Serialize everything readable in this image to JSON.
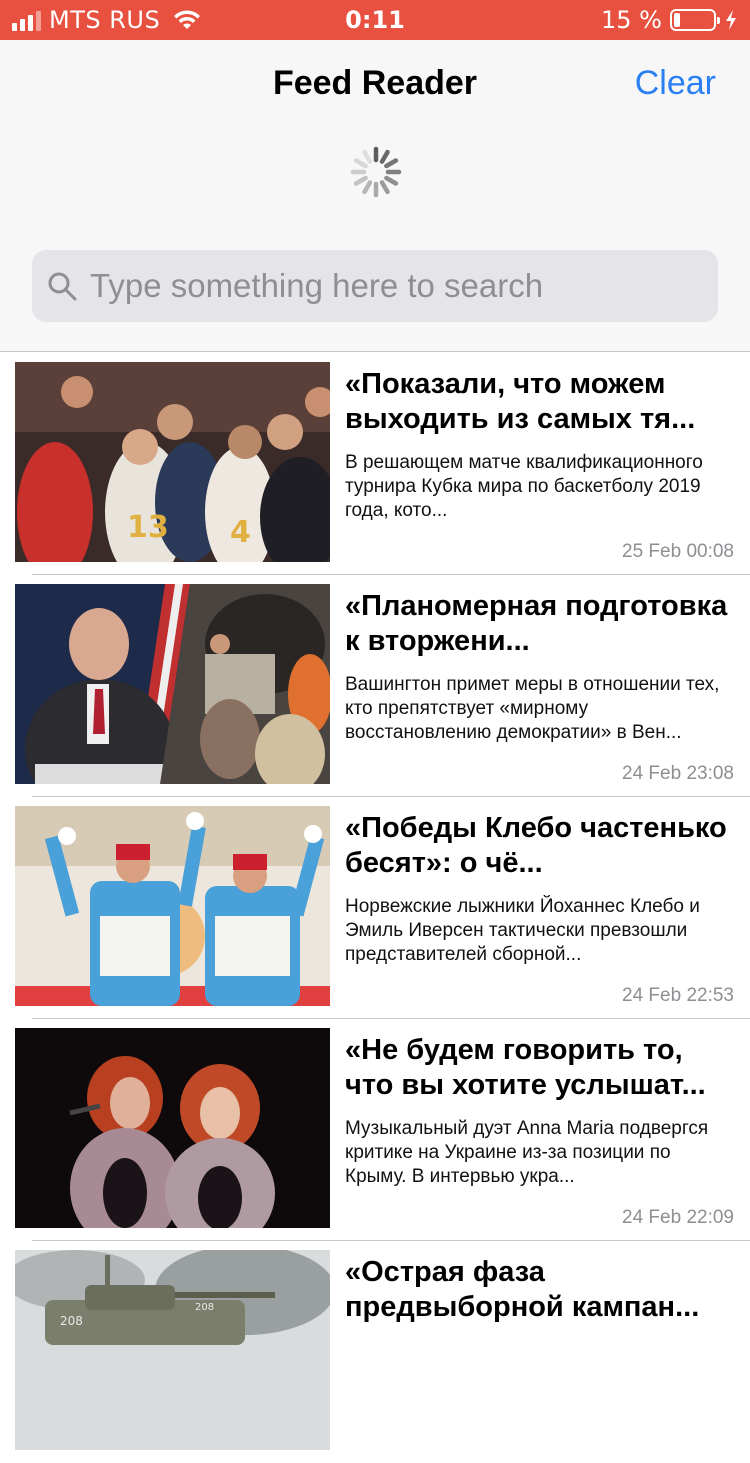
{
  "status_bar": {
    "carrier": "MTS RUS",
    "time": "0:11",
    "battery_percent": "15 %",
    "battery_level": 0.15,
    "charging": true
  },
  "nav": {
    "title": "Feed Reader",
    "clear_label": "Clear",
    "loading": true
  },
  "search": {
    "placeholder": "Type something here to search",
    "value": ""
  },
  "colors": {
    "status_bar_bg": "#e8503f",
    "accent": "#2a7ff3",
    "date_text": "#8e8e93",
    "search_bg": "#e4e4e9"
  },
  "feed": {
    "items": [
      {
        "title": "«Показали, что можем выходить из самых тя...",
        "summary": "В решающем матче квалификационного турнира Кубка мира по баскетболу 2019 года, кото...",
        "date": "25 Feb 00:08",
        "image": "basketball-team-photo"
      },
      {
        "title": "«Планомерная подготовка к вторжени...",
        "summary": "Вашингтон примет меры в отношении тех, кто препятствует «мирному восстановлению демократии» в Вен...",
        "date": "24 Feb 23:08",
        "image": "politician-and-protest-photo"
      },
      {
        "title": "«Победы Клебо частенько бесят»: о чё...",
        "summary": "Норвежские лыжники Йоханнес Клебо и Эмиль Иверсен тактически превзошли представителей сборной...",
        "date": "24 Feb 22:53",
        "image": "skiers-celebrating-photo"
      },
      {
        "title": "«Не будем говорить то, что вы хотите услышат...",
        "summary": "Музыкальный дуэт Anna Maria подвергся критике на Украине из-за позиции по Крыму. В интервью укра...",
        "date": "24 Feb 22:09",
        "image": "singers-on-stage-photo"
      },
      {
        "title": "«Острая фаза предвыборной кампан...",
        "summary": "",
        "date": "",
        "image": "armored-vehicle-photo"
      }
    ]
  }
}
